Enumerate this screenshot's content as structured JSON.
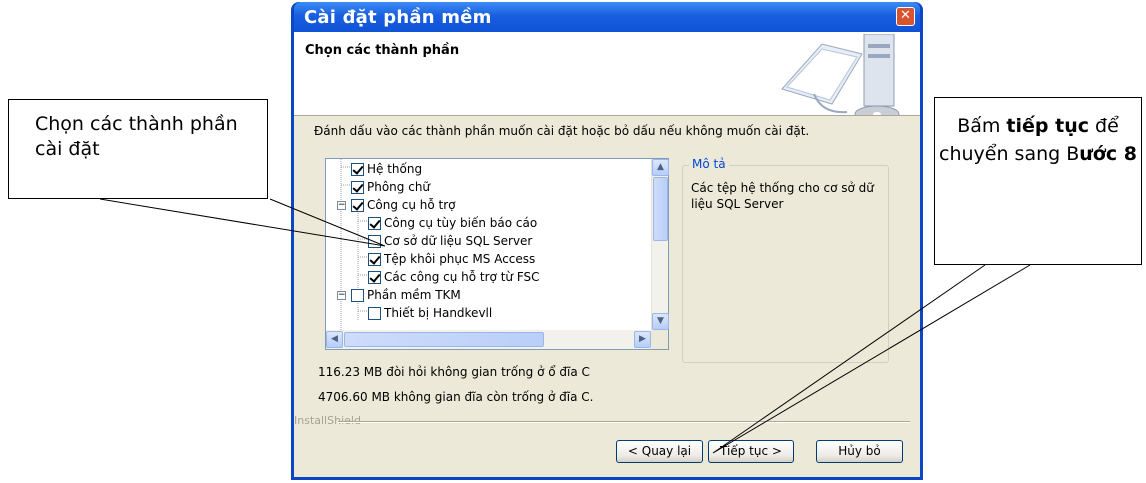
{
  "window": {
    "title": "Cài đặt phần mềm",
    "close_glyph": "✕",
    "header_title": "Chọn các thành phần",
    "instruction": "Đánh dấu vào các thành phần muốn cài đặt hoặc bỏ dấu nếu không muốn cài đặt."
  },
  "tree": {
    "items": [
      {
        "label": "Hệ thống",
        "checked": true
      },
      {
        "label": "Phông chữ",
        "checked": true
      },
      {
        "label": "Công cụ hỗ trợ",
        "checked": true,
        "expander": "−"
      },
      {
        "label": "Công cụ tùy biến báo cáo",
        "checked": true
      },
      {
        "label": "Cơ sở dữ liệu SQL Server",
        "checked": false
      },
      {
        "label": "Tệp khôi phục MS Access",
        "checked": true
      },
      {
        "label": "Các công cụ hỗ trợ từ FSC",
        "checked": true
      },
      {
        "label": "Phần mềm TKM",
        "checked": false,
        "expander": "−"
      },
      {
        "label": "Thiết bị Handkevll",
        "checked": false
      }
    ]
  },
  "description": {
    "label": "Mô tả",
    "text": "Các tệp hệ thống cho cơ sở dữ liệu SQL Server"
  },
  "space": {
    "required": "116.23 MB đòi hỏi không gian trống ở ổ đĩa C",
    "available": "4706.60 MB không gian đĩa còn trống ở đĩa C."
  },
  "installshield": "InstallShield",
  "buttons": {
    "back": "< Quay lại",
    "next": "Tiếp tục >",
    "cancel": "Hủy bỏ"
  },
  "callouts": {
    "left": "Chọn các thành phần cài đặt",
    "right_pre": "Bấm ",
    "right_bold": "tiếp tục",
    "right_mid": " để chuyển sang B",
    "right_step": "ước 8"
  },
  "icons": {
    "close": "close-icon",
    "scroll_up": "scroll-up-arrow-icon",
    "scroll_down": "scroll-down-arrow-icon",
    "scroll_left": "scroll-left-arrow-icon",
    "scroll_right": "scroll-right-arrow-icon",
    "header_art": "computer-cd-icon"
  },
  "colors": {
    "titlebar": "#0f52d6",
    "dialog_bg": "#ece9d8",
    "group_label": "#0046d5"
  }
}
